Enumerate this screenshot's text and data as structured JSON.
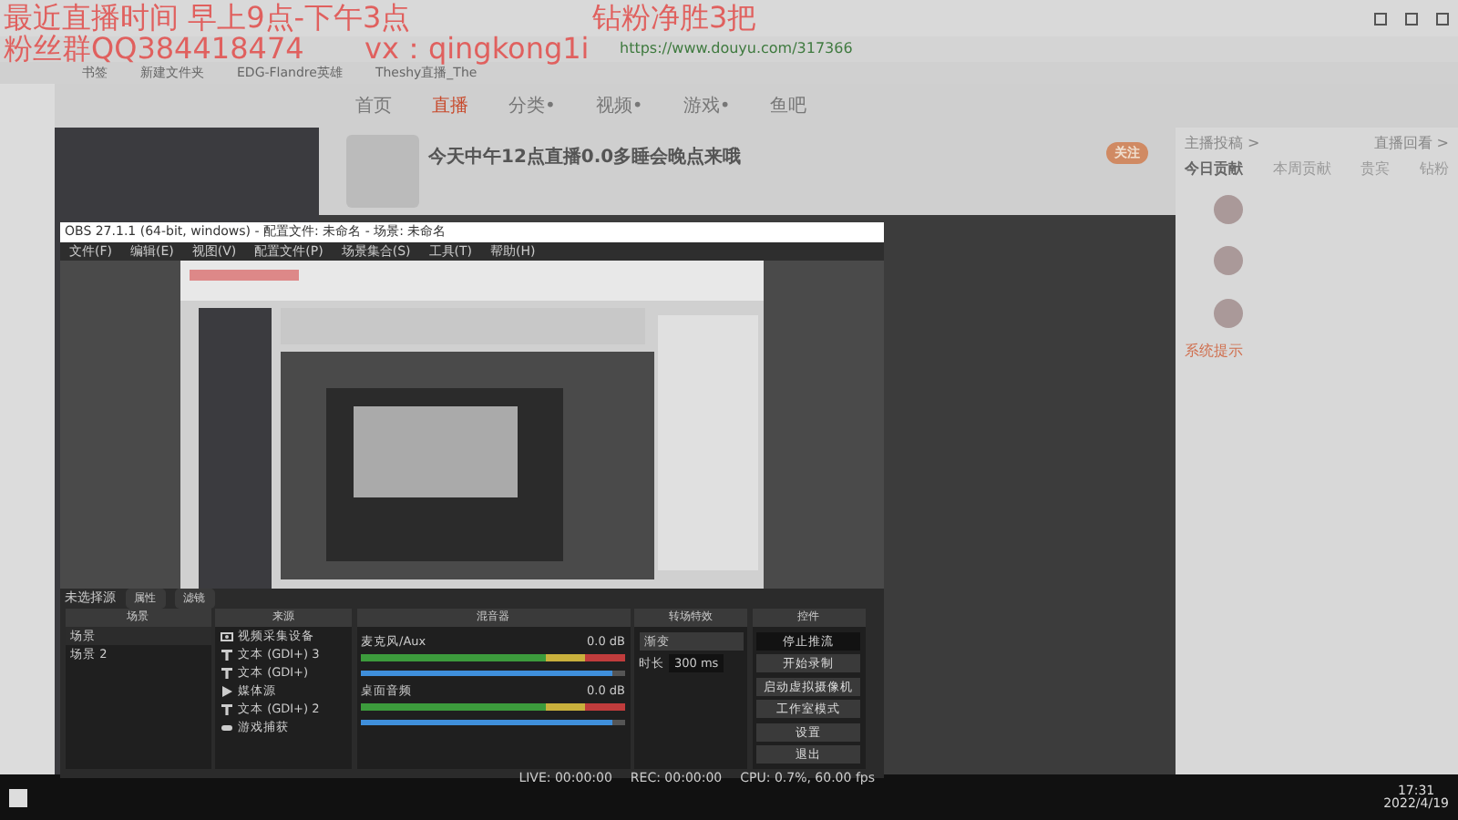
{
  "overlay_texts": [
    {
      "text": "最近直播时间 早上9点-下午3点"
    },
    {
      "text": "钻粉净胜3把"
    },
    {
      "text": "粉丝群QQ384418474"
    },
    {
      "text": "vx：qingkong1i"
    }
  ],
  "browser": {
    "url": "https://www.douyu.com/317366",
    "bookmarks": [
      "书签",
      "新建文件夹",
      "EDG-Flandre英雄",
      "Theshy直播_The"
    ]
  },
  "site_nav": [
    {
      "label": "首页",
      "selected": false
    },
    {
      "label": "直播",
      "selected": true
    },
    {
      "label": "分类•",
      "selected": false
    },
    {
      "label": "视频•",
      "selected": false
    },
    {
      "label": "游戏•",
      "selected": false
    },
    {
      "label": "鱼吧",
      "selected": false
    }
  ],
  "stream": {
    "title": "今天中午12点直播0.0多睡会晚点来哦",
    "follow": "关注",
    "links": [
      "主播投稿 >",
      "直播回看 >"
    ],
    "rank_tabs": [
      {
        "label": "今日贡献",
        "selected": true
      },
      {
        "label": "本周贡献",
        "selected": false
      },
      {
        "label": "贵宾",
        "selected": false
      },
      {
        "label": "钻粉",
        "selected": false
      }
    ],
    "notice_label": "系统提示"
  },
  "obs": {
    "title": "OBS 27.1.1 (64-bit, windows) - 配置文件: 未命名 - 场景: 未命名",
    "menu": [
      "文件(F)",
      "编辑(E)",
      "视图(V)",
      "配置文件(P)",
      "场景集合(S)",
      "工具(T)",
      "帮助(H)"
    ],
    "no_source": "未选择源",
    "source_buttons": [
      "属性",
      "滤镜"
    ],
    "docks": [
      "场景",
      "来源",
      "混音器",
      "转场特效",
      "控件"
    ],
    "scenes": [
      {
        "name": "场景",
        "selected": true
      },
      {
        "name": "场景 2",
        "selected": false
      }
    ],
    "sources": [
      {
        "name": "视频采集设备",
        "kind": "camera"
      },
      {
        "name": "文本 (GDI+) 3",
        "kind": "text"
      },
      {
        "name": "文本 (GDI+)",
        "kind": "text"
      },
      {
        "name": "媒体源",
        "kind": "media"
      },
      {
        "name": "文本 (GDI+) 2",
        "kind": "text"
      },
      {
        "name": "游戏捕获",
        "kind": "game"
      }
    ],
    "mixer": [
      {
        "name": "麦克风/Aux",
        "reading": "0.0 dB",
        "level": 0.95
      },
      {
        "name": "桌面音频",
        "reading": "0.0 dB",
        "level": 0.95
      }
    ],
    "transition": {
      "type": "渐变",
      "duration_label": "时长",
      "duration": "300 ms"
    },
    "controls": [
      {
        "label": "停止推流",
        "active": true
      },
      {
        "label": "开始录制",
        "active": false
      },
      {
        "label": "启动虚拟摄像机",
        "active": false
      },
      {
        "label": "工作室模式",
        "active": false
      },
      {
        "label": "设置",
        "active": false
      },
      {
        "label": "退出",
        "active": false
      }
    ],
    "status": [
      "LIVE: 00:00:00",
      "REC: 00:00:00",
      "CPU: 0.7%, 60.00 fps"
    ]
  },
  "taskbar": {
    "time": "17:31",
    "date": "2022/4/19"
  }
}
